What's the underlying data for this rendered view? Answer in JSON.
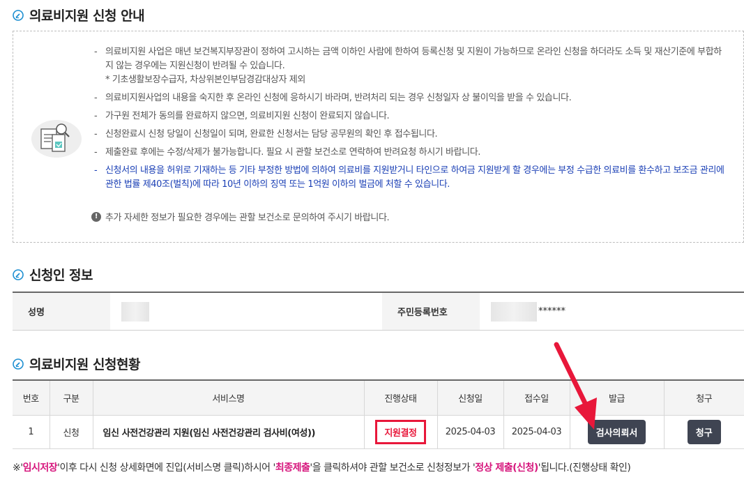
{
  "notice": {
    "title": "의료비지원 신청 안내",
    "items": [
      {
        "text": "의료비지원 사업은 매년 보건복지부장관이 정하여 고시하는 금액 이하인 사람에 한하여 등록신청 및 지원이 가능하므로 온라인 신청을 하더라도 소득 및 재산기준에 부합하지 않는 경우에는 지원신청이 반려될 수 있습니다.",
        "sub": "* 기초생활보장수급자, 차상위본인부담경감대상자 제외"
      },
      {
        "text": "의료비지원사업의 내용을 숙지한 후 온라인 신청에 응하시기 바라며, 반려처리 되는 경우 신청일자 상 불이익을 받을 수 있습니다."
      },
      {
        "text": "가구원 전체가 동의를 완료하지 않으면, 의료비지원 신청이 완료되지 않습니다."
      },
      {
        "text": "신청완료시 신청 당일이 신청일이 되며, 완료한 신청서는 담당 공무원의 확인 후 접수됩니다."
      },
      {
        "text": "제출완료 후에는 수정/삭제가 불가능합니다. 필요 시 관할 보건소로 연락하여 반려요청 하시기 바랍니다."
      },
      {
        "text": "신청서의 내용을 허위로 기재하는 등 기타 부정한 방법에 의하여 의료비를 지원받거니 타인으로 하여금 지원받게 할 경우에는 부정 수급한 의료비를 환수하고 보조금 관리에 관한 법률 제40조(벌칙)에 따라 10년 이하의 징역 또는 1억원 이하의 벌금에 처할 수 있습니다."
      }
    ],
    "dash": "-",
    "info": "추가 자세한 정보가 필요한 경우에는 관할 보건소로 문의하여 주시기 바랍니다.",
    "info_icon": "!"
  },
  "applicant": {
    "title": "신청인 정보",
    "name_label": "성명",
    "rrn_label": "주민등록번호",
    "rrn_mask": "******"
  },
  "status": {
    "title": "의료비지원 신청현황",
    "headers": [
      "번호",
      "구분",
      "서비스명",
      "진행상태",
      "신청일",
      "접수일",
      "발급",
      "청구"
    ],
    "row": {
      "no": "1",
      "type": "신청",
      "service": "임신 사전건강관리 지원(임신 사전건강관리 검사비(여성))",
      "state": "지원결정",
      "applied": "2025-04-03",
      "received": "2025-04-03",
      "issue_btn": "검사의뢰서",
      "claim_btn": "청구"
    }
  },
  "footnote": {
    "p1": "※'",
    "h1": "임시저장",
    "p2": "'이후 다시 신청 상세화면에 진입(서비스명 클릭)하시어 '",
    "h2": "최종제출",
    "p3": "'을 클릭하셔야 관할 보건소로 신청정보가 '",
    "h3": "정상 제출(신청)",
    "p4": "'됩니다.(진행상태 확인)"
  },
  "colors": {
    "accent_red": "#e8173a",
    "notice_blue": "#1a3fb5",
    "highlight_pink": "#d6157c",
    "button_dark": "#3f4452"
  }
}
